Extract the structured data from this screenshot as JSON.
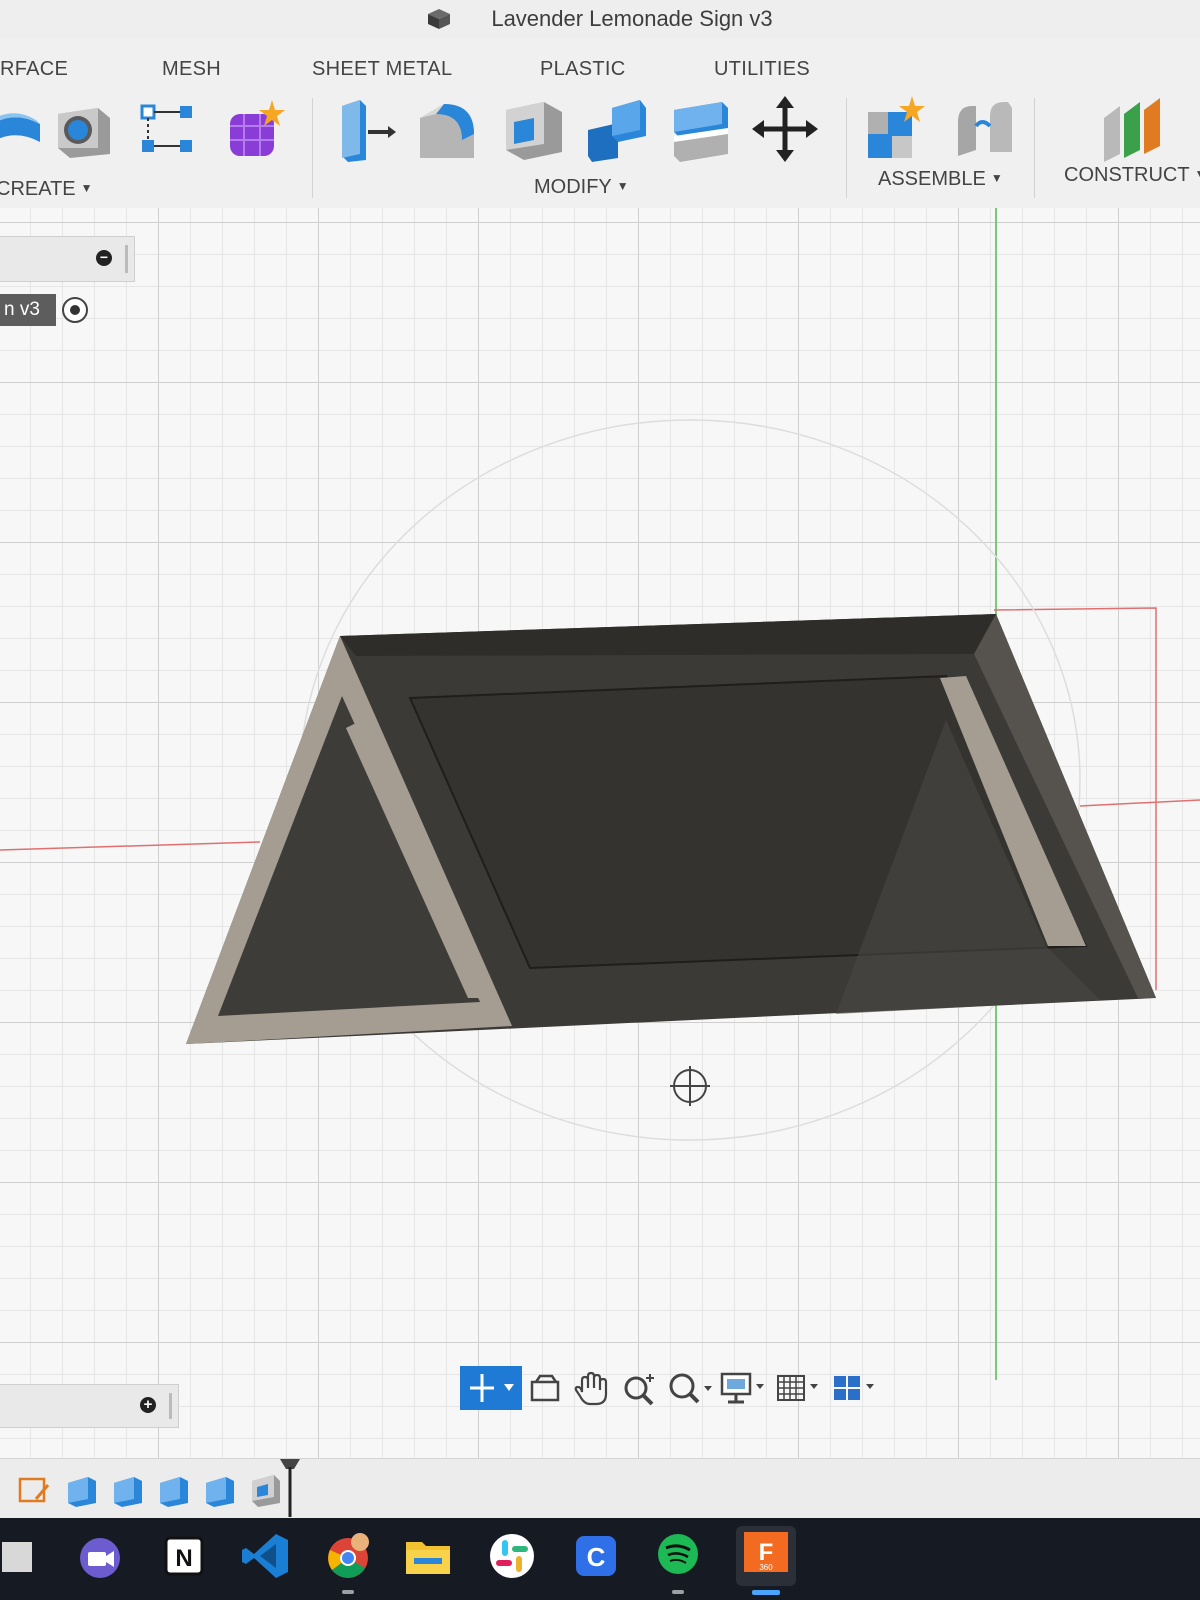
{
  "window": {
    "title": "Lavender Lemonade Sign v3",
    "doc_icon": "cube-document-icon"
  },
  "toolbar": {
    "tabs": [
      {
        "label": "RFACE"
      },
      {
        "label": "MESH"
      },
      {
        "label": "SHEET METAL"
      },
      {
        "label": "PLASTIC"
      },
      {
        "label": "UTILITIES"
      }
    ],
    "groups": {
      "create": {
        "label": "CREATE",
        "tools": [
          "extrude-surface-icon",
          "hole-icon",
          "pattern-icon",
          "create-form-icon"
        ]
      },
      "modify": {
        "label": "MODIFY",
        "tools": [
          "press-pull-icon",
          "fillet-icon",
          "shell-icon",
          "combine-icon",
          "split-body-icon",
          "move-icon"
        ]
      },
      "assemble": {
        "label": "ASSEMBLE",
        "tools": [
          "new-component-icon",
          "joint-icon"
        ]
      },
      "construct": {
        "label": "CONSTRUCT",
        "tools": [
          "offset-plane-icon"
        ]
      }
    },
    "dropdown_caret": "▼"
  },
  "browser": {
    "document_node": "n v3"
  },
  "navigation": {
    "tools": [
      "orbit-icon",
      "look-at-icon",
      "pan-icon",
      "zoom-icon",
      "fit-icon",
      "display-settings-icon",
      "grid-icon",
      "viewports-icon"
    ]
  },
  "timeline": {
    "items": [
      "sketch-feature-icon",
      "extrude-feature-icon",
      "extrude-feature-icon",
      "extrude-feature-icon",
      "extrude-feature-icon",
      "shell-feature-icon",
      "timeline-marker-icon"
    ]
  },
  "taskbar": {
    "apps": [
      "start-icon",
      "teams-icon",
      "notion-icon",
      "vscode-icon",
      "chrome-icon",
      "file-explorer-icon",
      "slack-icon",
      "canva-icon",
      "spotify-icon",
      "fusion360-icon"
    ],
    "notion_letter": "N",
    "canva_letter": "C",
    "fusion_letter": "F",
    "fusion_sub": "360"
  },
  "colors": {
    "accent_blue": "#1f7ad6",
    "model_dark": "#3c3a37",
    "model_light": "#a59d92",
    "taskbar": "#161a22"
  }
}
